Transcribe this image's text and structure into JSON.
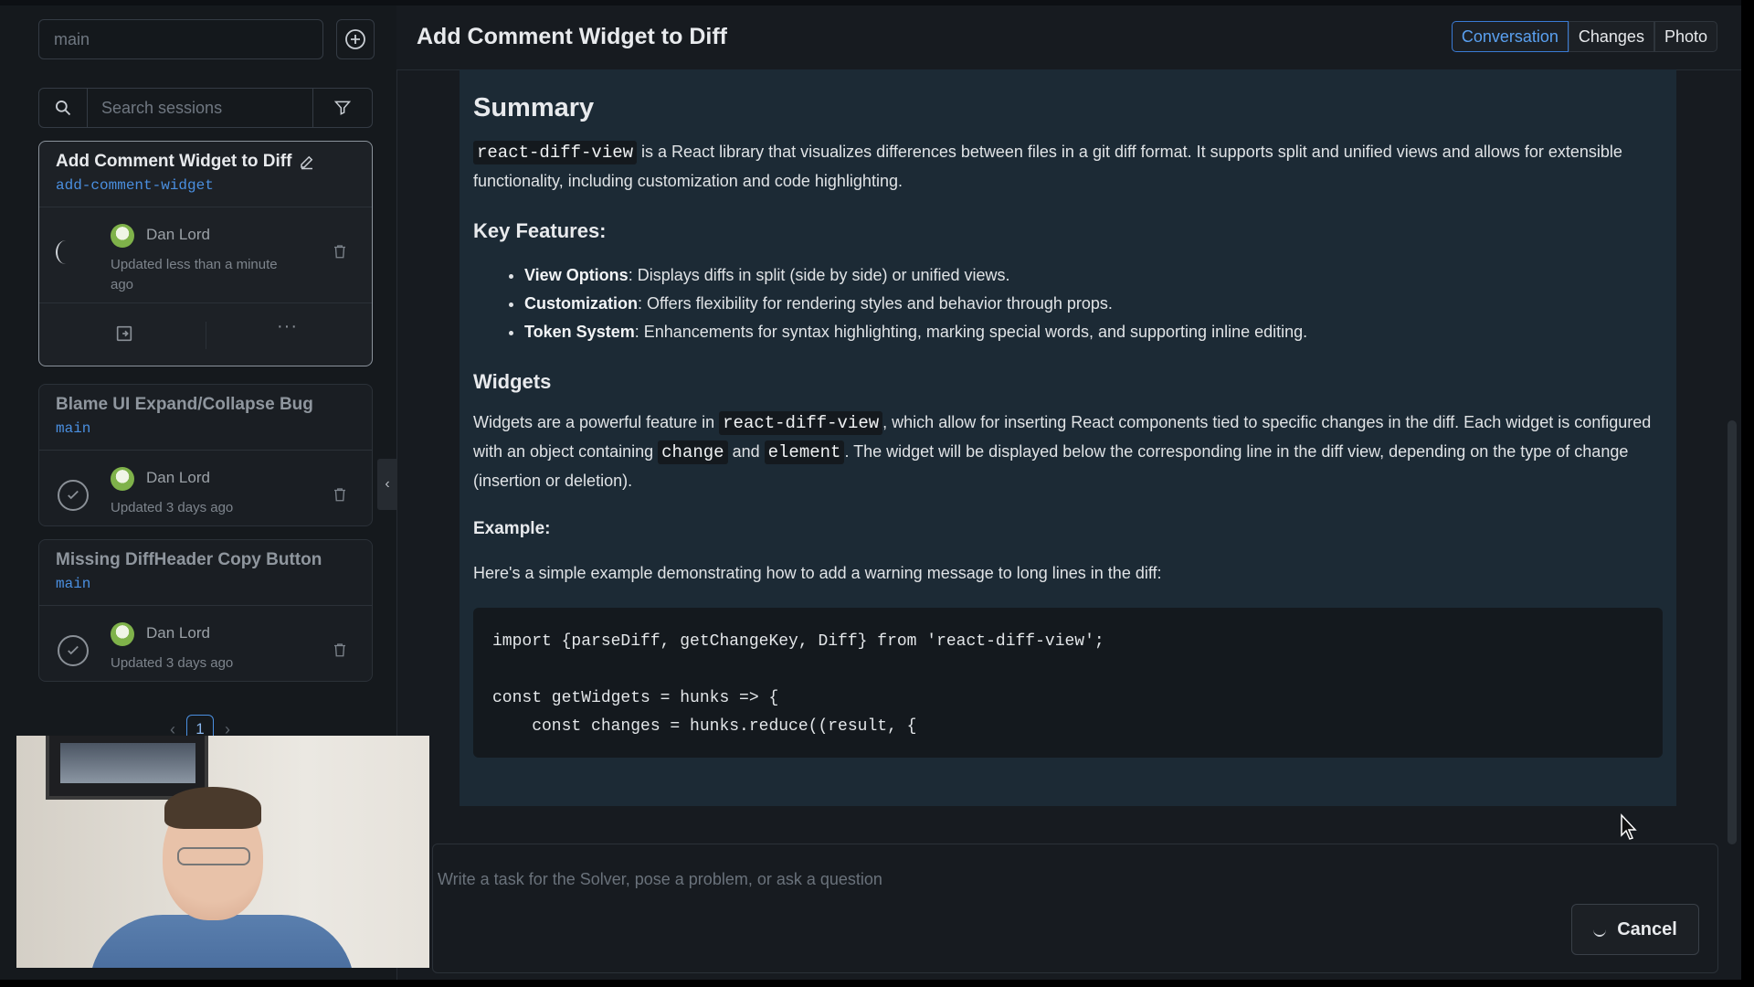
{
  "sidebar": {
    "branch_input": "main",
    "search_placeholder": "Search sessions",
    "sessions": [
      {
        "title": "Add Comment Widget to Diff",
        "branch": "add-comment-widget",
        "user": "Dan Lord",
        "updated": "Updated less than a minute ago",
        "status": "running"
      },
      {
        "title": "Blame UI Expand/Collapse Bug",
        "branch": "main",
        "user": "Dan Lord",
        "updated": "Updated 3 days ago",
        "status": "done"
      },
      {
        "title": "Missing DiffHeader Copy Button",
        "branch": "main",
        "user": "Dan Lord",
        "updated": "Updated 3 days ago",
        "status": "done"
      }
    ],
    "pager": {
      "current": "1"
    }
  },
  "header": {
    "title": "Add Comment Widget to Diff",
    "tabs": [
      "Conversation",
      "Changes",
      "Photo"
    ]
  },
  "content": {
    "summary_heading": "Summary",
    "summary_code": "react-diff-view",
    "summary_text": " is a React library that visualizes differences between files in a git diff format. It supports split and unified views and allows for extensible functionality, including customization and code highlighting.",
    "features_heading": "Key Features:",
    "features": [
      {
        "name": "View Options",
        "desc": ": Displays diffs in split (side by side) or unified views."
      },
      {
        "name": "Customization",
        "desc": ": Offers flexibility for rendering styles and behavior through props."
      },
      {
        "name": "Token System",
        "desc": ": Enhancements for syntax highlighting, marking special words, and supporting inline editing."
      }
    ],
    "widgets_heading": "Widgets",
    "widgets_p1": "Widgets are a powerful feature in ",
    "widgets_code1": "react-diff-view",
    "widgets_p2": ", which allow for inserting React components tied to specific changes in the diff. Each widget is configured with an object containing ",
    "widgets_code2": "change",
    "widgets_p3": " and ",
    "widgets_code3": "element",
    "widgets_p4": ". The widget will be displayed below the corresponding line in the diff view, depending on the type of change (insertion or deletion).",
    "example_heading": "Example:",
    "example_text": "Here's a simple example demonstrating how to add a warning message to long lines in the diff:",
    "code_lines": [
      "import {parseDiff, getChangeKey, Diff} from 'react-diff-view';",
      "",
      "const getWidgets = hunks => {",
      "    const changes = hunks.reduce((result, {"
    ]
  },
  "composer": {
    "placeholder": "Write a task for the Solver, pose a problem, or ask a question",
    "cancel_label": "Cancel"
  },
  "colors": {
    "accent": "#3a7bd5",
    "branch": "#4a8fe0",
    "panel": "#1c2a35"
  }
}
